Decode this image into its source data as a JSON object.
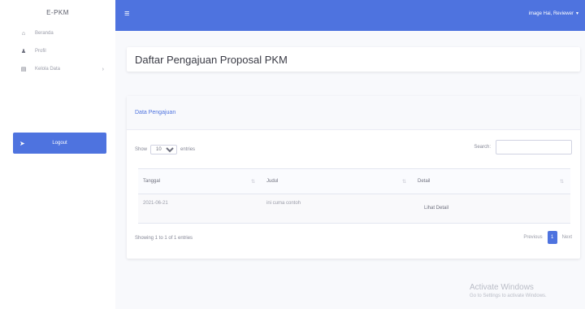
{
  "sidebar": {
    "brand": "E-PKM",
    "items": [
      {
        "label": "Beranda",
        "icon": "home-icon",
        "glyph": "⌂"
      },
      {
        "label": "Profil",
        "icon": "user-icon",
        "glyph": "♟"
      },
      {
        "label": "Kelola Data",
        "icon": "file-icon",
        "glyph": "▤",
        "chevron": "›"
      }
    ],
    "logout": {
      "label": "Logout",
      "glyph": "➤"
    }
  },
  "topbar": {
    "menu_glyph": "≡",
    "user_label": "image Hai, Reviewer",
    "user_caret": "▾"
  },
  "page_title": "Daftar Pengajuan Proposal PKM",
  "card": {
    "header": "Data Pengajuan",
    "show_label": "Show",
    "entries_value": "10",
    "entries_label": "entries",
    "search_label": "Search:",
    "search_value": "",
    "columns": [
      "Tanggal",
      "Judul",
      "Detail"
    ],
    "rows": [
      {
        "tanggal": "2021-06-21",
        "judul": "ini cuma contoh",
        "detail": "Lihat Detail"
      }
    ],
    "info": "Showing 1 to 1 of 1 entries",
    "pagination": {
      "previous": "Previous",
      "current": "1",
      "next": "Next"
    }
  },
  "watermark": {
    "line1": "Activate Windows",
    "line2": "Go to Settings to activate Windows."
  },
  "colors": {
    "primary": "#4e73df",
    "background": "#f8f9fc"
  }
}
